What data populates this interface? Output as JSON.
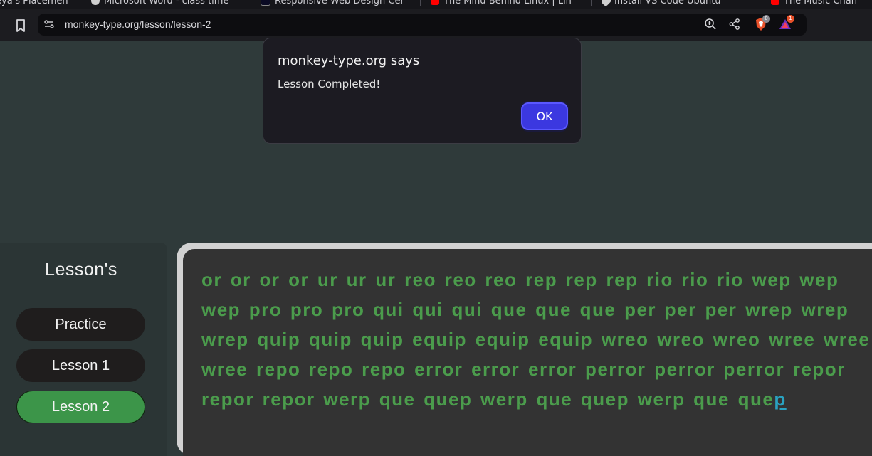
{
  "browser": {
    "tabs": [
      {
        "label": "eya's Placemen",
        "icon_color": "#e0e0e0"
      },
      {
        "label": "Microsoft Word - class time",
        "icon_color": "#cfcfcf"
      },
      {
        "label": "Responsive Web Design Cer",
        "icon_color": "#0a0a23"
      },
      {
        "label": "The Mind Behind Linux | Lin",
        "icon_color": "#ff0000"
      },
      {
        "label": "Install VS Code Ubuntu",
        "icon_color": "#cfcfcf"
      },
      {
        "label": "The Music Chan",
        "icon_color": "#ff0000"
      }
    ],
    "url": "monkey-type.org/lesson/lesson-2",
    "icons": [
      "bookmark-icon",
      "site-info-icon",
      "zoom-icon",
      "share-icon",
      "brave-shields-icon",
      "brave-rewards-icon"
    ],
    "shields_badge": "0",
    "rewards_badge": "1"
  },
  "sidebar": {
    "title": "Lesson's",
    "items": [
      {
        "label": "Practice",
        "active": false
      },
      {
        "label": "Lesson 1",
        "active": false
      },
      {
        "label": "Lesson 2",
        "active": true
      }
    ]
  },
  "typing": {
    "text_before_cursor": "or or or or ur ur ur reo reo reo rep rep rep rio rio rio wep wep wep pro pro pro qui qui qui que que que per per per wrep wrep wrep quip quip quip equip equip equip wreo wreo wreo wree wree wree repo repo repo error error error perror perror perror repor repor repor werp que quep werp que quep werp que que",
    "cursor_char": "p"
  },
  "dialog": {
    "title": "monkey-type.org says",
    "message": "Lesson Completed!",
    "ok_label": "OK"
  },
  "colors": {
    "page_bg": "#2f3a3a",
    "typed_text": "#4b9c4c",
    "cursor_char": "#2aa2c0",
    "active_lesson": "#3c9549",
    "ok_button": "#3b38e0"
  }
}
